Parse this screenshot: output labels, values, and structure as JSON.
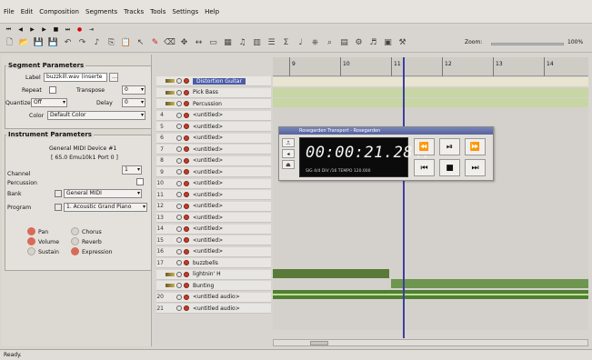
{
  "menu": [
    "File",
    "Edit",
    "Composition",
    "Segments",
    "Tracks",
    "Tools",
    "Settings",
    "Help"
  ],
  "zoom": {
    "label": "Zoom:",
    "value": "100%"
  },
  "segment_params": {
    "title": "Segment Parameters",
    "label_label": "Label",
    "label_value": "buzzkill.wav (inserte",
    "repeat_label": "Repeat",
    "transpose_label": "Transpose",
    "transpose_value": "0",
    "quantize_label": "Quantize",
    "quantize_value": "Off",
    "delay_label": "Delay",
    "delay_value": "0",
    "color_label": "Color",
    "color_value": "Default Color"
  },
  "instrument_params": {
    "title": "Instrument Parameters",
    "device": "General MIDI Device #1",
    "device_sub": "[ 65.0 Emu10k1 Port 0 ]",
    "channel_label": "Channel",
    "channel_value": "1",
    "percussion_label": "Percussion",
    "bank_label": "Bank",
    "bank_value": "General MIDI",
    "program_label": "Program",
    "program_value": "1. Acoustic Grand Piano",
    "knobs": [
      "Pan",
      "Chorus",
      "Volume",
      "Reverb",
      "Sustain",
      "Expression"
    ]
  },
  "tracks": [
    {
      "num": "",
      "name": "Distortion Guitar",
      "selected": true
    },
    {
      "num": "",
      "name": "Pick Bass"
    },
    {
      "num": "",
      "name": "Percussion"
    },
    {
      "num": "4",
      "name": "<untitled>"
    },
    {
      "num": "5",
      "name": "<untitled>"
    },
    {
      "num": "6",
      "name": "<untitled>"
    },
    {
      "num": "7",
      "name": "<untitled>"
    },
    {
      "num": "8",
      "name": "<untitled>"
    },
    {
      "num": "9",
      "name": "<untitled>"
    },
    {
      "num": "10",
      "name": "<untitled>"
    },
    {
      "num": "11",
      "name": "<untitled>"
    },
    {
      "num": "12",
      "name": "<untitled>"
    },
    {
      "num": "13",
      "name": "<untitled>"
    },
    {
      "num": "14",
      "name": "<untitled>"
    },
    {
      "num": "15",
      "name": "<untitled>"
    },
    {
      "num": "16",
      "name": "<untitled>"
    },
    {
      "num": "17",
      "name": "buzzbells"
    },
    {
      "num": "",
      "name": "lightnin' H"
    },
    {
      "num": "",
      "name": "Bunting"
    },
    {
      "num": "20",
      "name": "<untitled audio>"
    },
    {
      "num": "21",
      "name": "<untitled audio>"
    }
  ],
  "ruler_bars": [
    "9",
    "10",
    "11",
    "12",
    "13",
    "14"
  ],
  "transport": {
    "title": "Rosegarden Transport - Rosegarden",
    "time": "00:00:21.2847",
    "small": "SIG 4/4   DIV /16   TEMPO 120.000"
  },
  "status": "Ready."
}
